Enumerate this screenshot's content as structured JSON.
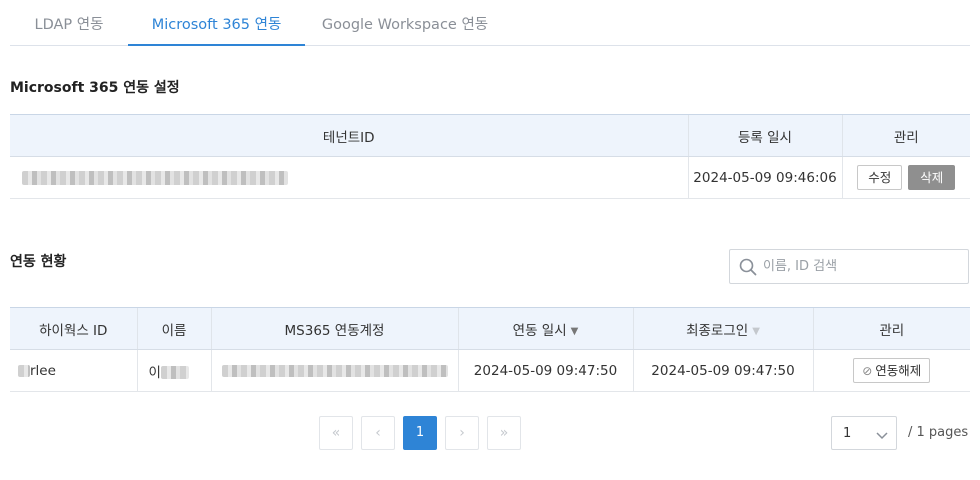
{
  "tabs": [
    {
      "label": "LDAP 연동"
    },
    {
      "label": "Microsoft 365 연동"
    },
    {
      "label": "Google Workspace 연동"
    }
  ],
  "settings": {
    "title": "Microsoft 365 연동 설정",
    "headers": [
      "테넌트ID",
      "등록 일시",
      "관리"
    ],
    "row": {
      "registered_at": "2024-05-09 09:46:06",
      "edit_label": "수정",
      "delete_label": "삭제"
    }
  },
  "status": {
    "title": "연동 현황",
    "search_placeholder": "이름, ID 검색",
    "headers": [
      "하이웍스 ID",
      "이름",
      "MS365 연동계정",
      "연동 일시",
      "최종로그인",
      "관리"
    ],
    "rows": [
      {
        "id_suffix": "rlee",
        "name_prefix": "이",
        "linked_at": "2024-05-09 09:47:50",
        "last_login": "2024-05-09 09:47:50",
        "unlink_label": "연동해제"
      }
    ]
  },
  "pagination": {
    "current_page": "1",
    "page_select_value": "1",
    "total_label": "/ 1 pages"
  },
  "colors": {
    "accent": "#2e84d6",
    "header_bg": "#eef4fc",
    "delete_bg": "#8f8f8f"
  },
  "icons": [
    "search-icon",
    "first-page-icon",
    "prev-page-icon",
    "next-page-icon",
    "last-page-icon",
    "chevron-down-icon",
    "ban-icon"
  ]
}
